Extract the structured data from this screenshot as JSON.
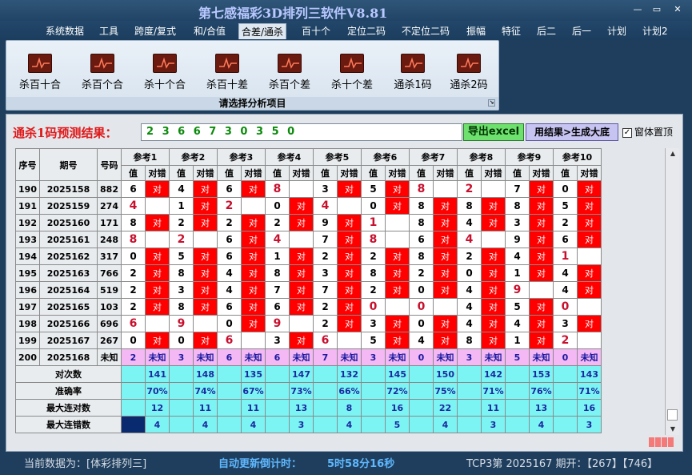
{
  "app": {
    "title": "第七感福彩3D排列三软件V8.81",
    "btn_min": "—",
    "btn_restore": "▭",
    "btn_close": "✕"
  },
  "menu": [
    "系统数据",
    "工具",
    "跨度/复式",
    "和/合值",
    "合差/通杀",
    "百十个",
    "定位二码",
    "不定位二码",
    "振幅",
    "特征",
    "后二",
    "后一",
    "计划",
    "计划2"
  ],
  "ribbon": {
    "buttons": [
      "杀百十合",
      "杀百个合",
      "杀十个合",
      "杀百十差",
      "杀百个差",
      "杀十个差",
      "通杀1码",
      "通杀2码"
    ],
    "caption": "请选择分析项目",
    "corner": "↘"
  },
  "prediction": {
    "label": "通杀1码预测结果：",
    "value": "2 3 6 6 7 3 0 3 5 0",
    "excel_btn": "导出excel",
    "gen_btn": "用结果>生成大底",
    "topmost_label": "窗体置顶",
    "topmost_checked": "✓"
  },
  "table": {
    "col_seq": "序号",
    "col_issue": "期号",
    "col_num": "号码",
    "refs": [
      "参考1",
      "参考2",
      "参考3",
      "参考4",
      "参考5",
      "参考6",
      "参考7",
      "参考8",
      "参考9",
      "参考10"
    ],
    "sub_val": "值",
    "sub_hit": "对错",
    "hit_text": "对",
    "unknown_text": "未知",
    "rows": [
      {
        "seq": "190",
        "issue": "2025158",
        "num": "882",
        "vals": [
          "6",
          "4",
          "6",
          "8",
          "3",
          "5",
          "8",
          "2",
          "7",
          "0"
        ],
        "hits": [
          1,
          1,
          1,
          0,
          1,
          1,
          0,
          0,
          1,
          1
        ]
      },
      {
        "seq": "191",
        "issue": "2025159",
        "num": "274",
        "vals": [
          "4",
          "1",
          "2",
          "0",
          "4",
          "0",
          "8",
          "8",
          "8",
          "5"
        ],
        "hits": [
          0,
          1,
          0,
          1,
          0,
          1,
          1,
          1,
          1,
          1
        ]
      },
      {
        "seq": "192",
        "issue": "2025160",
        "num": "171",
        "vals": [
          "8",
          "2",
          "2",
          "2",
          "9",
          "1",
          "8",
          "4",
          "3",
          "2"
        ],
        "hits": [
          1,
          1,
          1,
          1,
          1,
          0,
          1,
          1,
          1,
          1
        ]
      },
      {
        "seq": "193",
        "issue": "2025161",
        "num": "248",
        "vals": [
          "8",
          "2",
          "6",
          "4",
          "7",
          "8",
          "6",
          "4",
          "9",
          "6"
        ],
        "hits": [
          0,
          0,
          1,
          0,
          1,
          0,
          1,
          0,
          1,
          1
        ]
      },
      {
        "seq": "194",
        "issue": "2025162",
        "num": "317",
        "vals": [
          "0",
          "5",
          "6",
          "1",
          "2",
          "2",
          "8",
          "2",
          "4",
          "1"
        ],
        "hits": [
          1,
          1,
          1,
          1,
          1,
          1,
          1,
          1,
          1,
          0
        ]
      },
      {
        "seq": "195",
        "issue": "2025163",
        "num": "766",
        "vals": [
          "2",
          "8",
          "4",
          "8",
          "3",
          "8",
          "2",
          "0",
          "1",
          "4"
        ],
        "hits": [
          1,
          1,
          1,
          1,
          1,
          1,
          1,
          1,
          1,
          1
        ]
      },
      {
        "seq": "196",
        "issue": "2025164",
        "num": "519",
        "vals": [
          "2",
          "3",
          "4",
          "7",
          "7",
          "2",
          "0",
          "4",
          "9",
          "4"
        ],
        "hits": [
          1,
          1,
          1,
          1,
          1,
          1,
          1,
          1,
          0,
          1
        ]
      },
      {
        "seq": "197",
        "issue": "2025165",
        "num": "103",
        "vals": [
          "2",
          "8",
          "6",
          "6",
          "2",
          "0",
          "0",
          "4",
          "5",
          "0"
        ],
        "hits": [
          1,
          1,
          1,
          1,
          1,
          0,
          0,
          1,
          1,
          0
        ]
      },
      {
        "seq": "198",
        "issue": "2025166",
        "num": "696",
        "vals": [
          "6",
          "9",
          "0",
          "9",
          "2",
          "3",
          "0",
          "4",
          "4",
          "3"
        ],
        "hits": [
          0,
          0,
          1,
          0,
          1,
          1,
          1,
          1,
          1,
          1
        ]
      },
      {
        "seq": "199",
        "issue": "2025167",
        "num": "267",
        "vals": [
          "0",
          "0",
          "6",
          "3",
          "6",
          "5",
          "4",
          "8",
          "1",
          "2"
        ],
        "hits": [
          1,
          1,
          0,
          1,
          0,
          1,
          1,
          1,
          1,
          0
        ]
      },
      {
        "seq": "200",
        "issue": "2025168",
        "num": "未知",
        "vals": [
          "2",
          "3",
          "6",
          "6",
          "7",
          "3",
          "0",
          "3",
          "5",
          "0"
        ],
        "hits": [
          2,
          2,
          2,
          2,
          2,
          2,
          2,
          2,
          2,
          2
        ]
      }
    ],
    "stats": [
      {
        "label": "对次数",
        "values": [
          "141",
          "148",
          "135",
          "147",
          "132",
          "145",
          "150",
          "142",
          "153",
          "143"
        ]
      },
      {
        "label": "准确率",
        "values": [
          "70%",
          "74%",
          "67%",
          "73%",
          "66%",
          "72%",
          "75%",
          "71%",
          "76%",
          "71%"
        ]
      },
      {
        "label": "最大连对数",
        "values": [
          "12",
          "11",
          "11",
          "13",
          "8",
          "16",
          "22",
          "11",
          "13",
          "16"
        ]
      },
      {
        "label": "最大连错数",
        "values": [
          "4",
          "4",
          "4",
          "3",
          "4",
          "5",
          "4",
          "3",
          "4",
          "3"
        ]
      }
    ]
  },
  "scroll": {
    "up": "▲",
    "down": "▼"
  },
  "status": {
    "source": "当前数据为：[体彩排列三]",
    "timer_label": "自动更新倒计时：",
    "timer": "5时58分16秒",
    "tcp": "TCP3第  2025167  期开：【267】【746】"
  }
}
